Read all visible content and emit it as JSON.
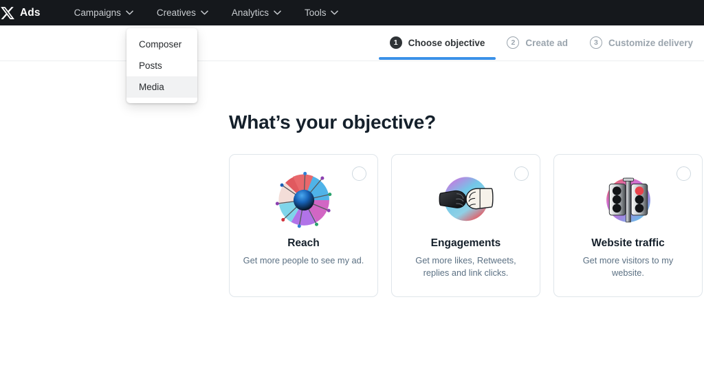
{
  "nav": {
    "logo_icon": "x-logo-icon",
    "brand": "Ads",
    "items": [
      {
        "label": "Campaigns",
        "icon": "chevron-down-icon"
      },
      {
        "label": "Creatives",
        "icon": "chevron-down-icon"
      },
      {
        "label": "Analytics",
        "icon": "chevron-down-icon"
      },
      {
        "label": "Tools",
        "icon": "chevron-down-icon"
      }
    ]
  },
  "dropdown": {
    "owner": "Creatives",
    "items": [
      {
        "label": "Composer",
        "hovered": false
      },
      {
        "label": "Posts",
        "hovered": false
      },
      {
        "label": "Media",
        "hovered": true
      }
    ]
  },
  "stepper": {
    "steps": [
      {
        "number": "1",
        "label": "Choose objective",
        "state": "active"
      },
      {
        "number": "2",
        "label": "Create ad",
        "state": "idle"
      },
      {
        "number": "3",
        "label": "Customize delivery",
        "state": "idle"
      }
    ],
    "active_color": "#3b91e8"
  },
  "main": {
    "title": "What’s your objective?",
    "objectives": [
      {
        "title": "Reach",
        "description": "Get more people to see my ad.",
        "icon": "reach-pinwheel-icon",
        "selected": false
      },
      {
        "title": "Engagements",
        "description": "Get more likes, Retweets, replies and link clicks.",
        "icon": "fist-bump-icon",
        "selected": false
      },
      {
        "title": "Website traffic",
        "description": "Get more visitors to my website.",
        "icon": "traffic-light-icon",
        "selected": false
      }
    ]
  }
}
